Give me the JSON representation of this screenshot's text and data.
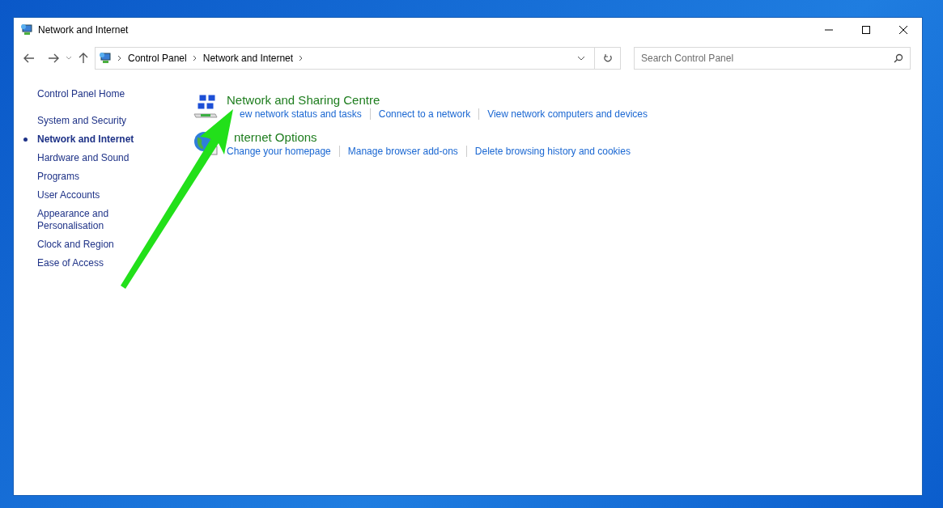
{
  "window": {
    "title": "Network and Internet"
  },
  "address_bar": {
    "crumbs": [
      "Control Panel",
      "Network and Internet"
    ]
  },
  "search": {
    "placeholder": "Search Control Panel"
  },
  "sidebar": {
    "items": [
      {
        "label": "Control Panel Home",
        "selected": false,
        "kind": "home"
      },
      {
        "label": "System and Security",
        "selected": false,
        "kind": "category"
      },
      {
        "label": "Network and Internet",
        "selected": true,
        "kind": "category"
      },
      {
        "label": "Hardware and Sound",
        "selected": false,
        "kind": "category"
      },
      {
        "label": "Programs",
        "selected": false,
        "kind": "category"
      },
      {
        "label": "User Accounts",
        "selected": false,
        "kind": "category"
      },
      {
        "label": "Appearance and Personalisation",
        "selected": false,
        "kind": "category"
      },
      {
        "label": "Clock and Region",
        "selected": false,
        "kind": "category"
      },
      {
        "label": "Ease of Access",
        "selected": false,
        "kind": "category"
      }
    ]
  },
  "sections": [
    {
      "kind": "network",
      "title": "Network and Sharing Centre",
      "links": [
        "ew network status and tasks",
        "Connect to a network",
        "View network computers and devices"
      ]
    },
    {
      "kind": "globe",
      "title": "nternet Options",
      "links": [
        "Change your homepage",
        "Manage browser add-ons",
        "Delete browsing history and cookies"
      ]
    }
  ],
  "annotation": {
    "kind": "arrow"
  }
}
